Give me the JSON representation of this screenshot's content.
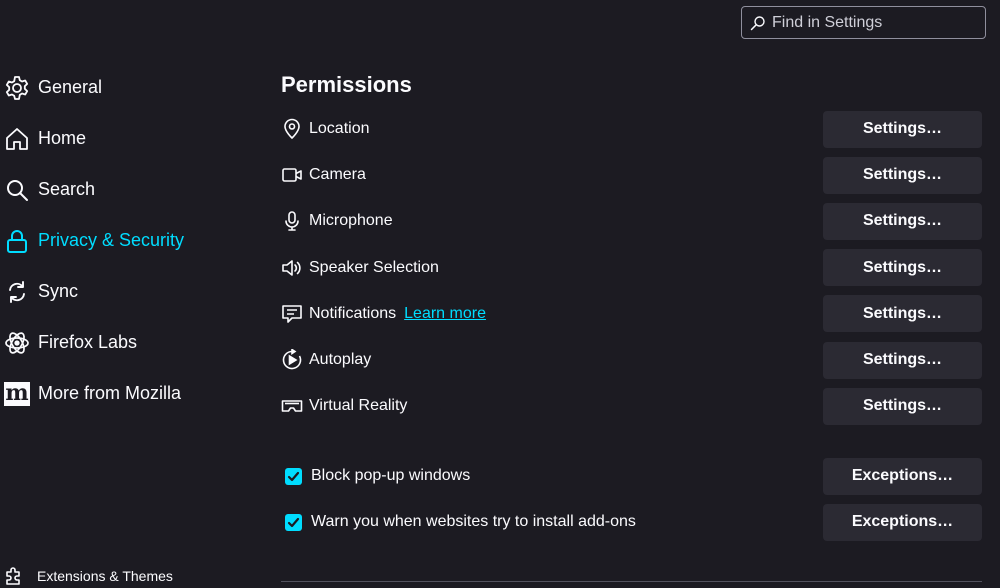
{
  "search": {
    "placeholder": "Find in Settings"
  },
  "sidebar": {
    "items": [
      {
        "label": "General",
        "icon": "gear-icon"
      },
      {
        "label": "Home",
        "icon": "home-icon"
      },
      {
        "label": "Search",
        "icon": "search-icon"
      },
      {
        "label": "Privacy & Security",
        "icon": "lock-icon",
        "active": true
      },
      {
        "label": "Sync",
        "icon": "sync-icon"
      },
      {
        "label": "Firefox Labs",
        "icon": "labs-icon"
      },
      {
        "label": "More from Mozilla",
        "icon": "mozilla-m-icon",
        "glyph": "m"
      }
    ],
    "footer": {
      "label": "Extensions & Themes",
      "icon": "puzzle-icon"
    }
  },
  "permissions": {
    "title": "Permissions",
    "rows": [
      {
        "label": "Location",
        "icon": "location-pin-icon",
        "button": "Settings…"
      },
      {
        "label": "Camera",
        "icon": "camera-icon",
        "button": "Settings…"
      },
      {
        "label": "Microphone",
        "icon": "microphone-icon",
        "button": "Settings…"
      },
      {
        "label": "Speaker Selection",
        "icon": "speaker-icon",
        "button": "Settings…"
      },
      {
        "label": "Notifications",
        "icon": "notification-icon",
        "button": "Settings…",
        "link": "Learn more"
      },
      {
        "label": "Autoplay",
        "icon": "autoplay-icon",
        "button": "Settings…"
      },
      {
        "label": "Virtual Reality",
        "icon": "vr-headset-icon",
        "button": "Settings…"
      }
    ],
    "checks": [
      {
        "label": "Block pop-up windows",
        "checked": true,
        "button": "Exceptions…"
      },
      {
        "label": "Warn you when websites try to install add-ons",
        "checked": true,
        "button": "Exceptions…"
      }
    ]
  },
  "colors": {
    "accent": "#00ddff",
    "background": "#1c1b22",
    "button": "#2b2a33",
    "text": "#fbfbfe"
  }
}
